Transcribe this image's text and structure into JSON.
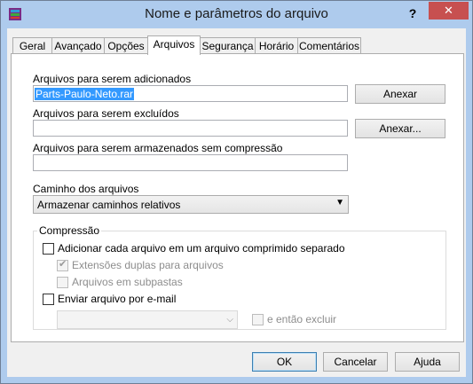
{
  "window": {
    "title": "Nome e parâmetros do arquivo",
    "help": "?",
    "close": "✕"
  },
  "tabs": [
    "Geral",
    "Avançado",
    "Opções",
    "Arquivos",
    "Segurança",
    "Horário",
    "Comentários"
  ],
  "active_tab": "Arquivos",
  "files": {
    "add_label": "Arquivos para serem adicionados",
    "add_value": "Parts-Paulo-Neto.rar",
    "attach_label": "Anexar",
    "exclude_label": "Arquivos para serem excluídos",
    "exclude_value": "",
    "attach2_label": "Anexar...",
    "store_label": "Arquivos para serem armazenados sem compressão",
    "store_value": ""
  },
  "paths": {
    "label": "Caminho dos arquivos",
    "selected": "Armazenar caminhos relativos"
  },
  "compression": {
    "title": "Compressão",
    "separate": {
      "label": "Adicionar cada arquivo em um arquivo comprimido separado",
      "checked": false
    },
    "double_ext": {
      "label": "Extensões duplas para arquivos",
      "checked": true,
      "disabled": true
    },
    "subfolders": {
      "label": "Arquivos em subpastas",
      "checked": false,
      "disabled": true
    },
    "email": {
      "label": "Enviar arquivo por e-mail",
      "checked": false
    },
    "email_combo": "",
    "delete_after": {
      "label": "e então excluir",
      "checked": false,
      "disabled": true
    }
  },
  "buttons": {
    "ok": "OK",
    "cancel": "Cancelar",
    "help": "Ajuda"
  },
  "colors": {
    "titlebar": "#aecbed",
    "close": "#c75050",
    "selection": "#3399ff"
  }
}
